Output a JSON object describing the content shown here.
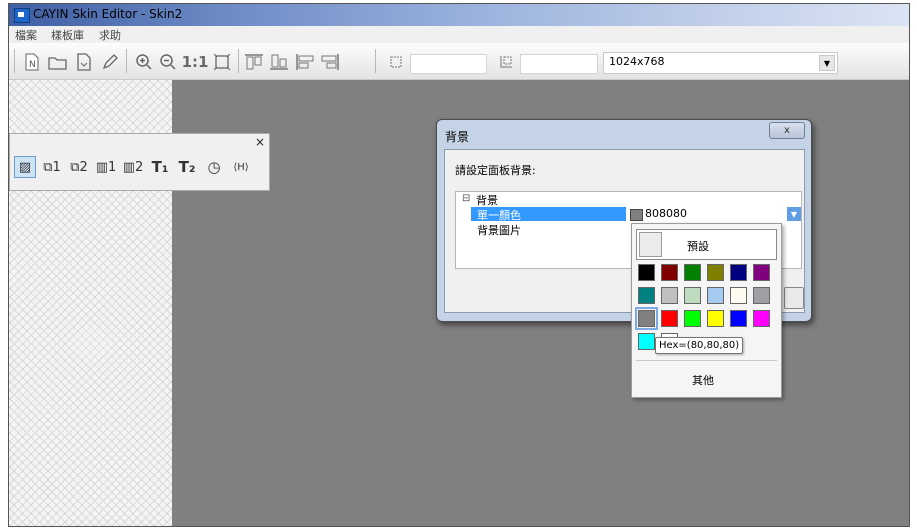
{
  "window": {
    "title": "CAYIN Skin Editor - Skin2"
  },
  "menu": [
    "檔案",
    "樣板庫",
    "求助"
  ],
  "toolbar": {
    "icons": [
      "new-icon",
      "open-icon",
      "save-icon",
      "edit-icon",
      "zoom-in-icon",
      "zoom-out-icon",
      "actual-size-icon",
      "fit-icon",
      "align-top-icon",
      "align-bottom-icon",
      "align-left-icon",
      "align-right-icon",
      "resize-icon",
      "position-icon"
    ],
    "actual_size_label": "1:1",
    "resolution": "1024x768"
  },
  "floating_toolbar": {
    "close": "×",
    "tools": [
      "image-tool-icon",
      "video-1-tool-icon",
      "video-2-tool-icon",
      "layer-1-tool-icon",
      "layer-2-tool-icon",
      "text-1-tool-icon",
      "text-2-tool-icon",
      "clock-tool-icon",
      "ticker-tool-icon"
    ],
    "labels": [
      "▨",
      "⧉1",
      "⧉2",
      "▥1",
      "▥2",
      "T₁",
      "T₂",
      "◷",
      "⟨H⟩"
    ]
  },
  "dialog": {
    "title": "背景",
    "close": "x",
    "prompt": "請設定面板背景:",
    "group": {
      "expander": "⊟",
      "label": "背景"
    },
    "rows": [
      {
        "label": "單一顏色",
        "value": "808080",
        "swatch": "#808080",
        "selected": true
      },
      {
        "label": "背景圖片",
        "value": ""
      }
    ]
  },
  "color_picker": {
    "default_label": "預設",
    "colors": [
      "#000000",
      "#800000",
      "#008000",
      "#808000",
      "#000080",
      "#800080",
      "#008080",
      "#c0c0c0",
      "#c0dcc0",
      "#a6caf0",
      "#fffbf0",
      "#a0a0a4",
      "#808080",
      "#ff0000",
      "#00ff00",
      "#ffff00",
      "#0000ff",
      "#ff00ff",
      "#00ffff",
      "#ffffff"
    ],
    "selected_index": 12,
    "tooltip": "Hex=(80,80,80)",
    "other_label": "其他"
  }
}
